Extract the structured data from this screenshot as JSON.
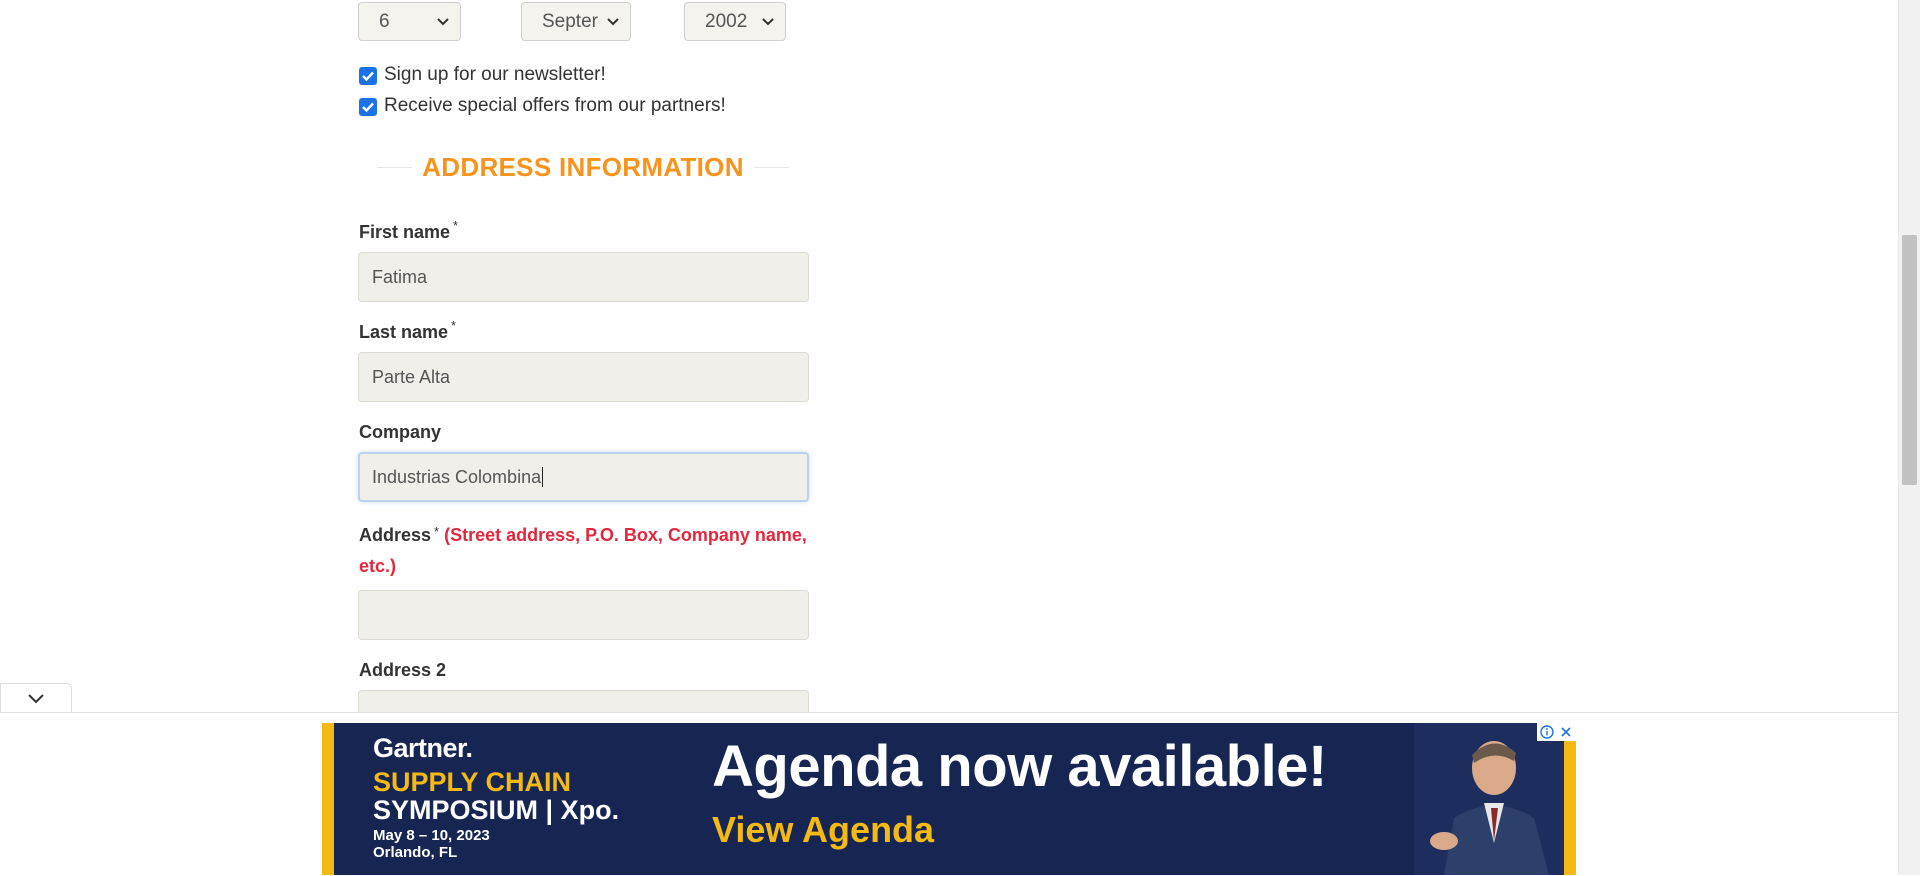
{
  "dob": {
    "day": "6",
    "month": "Septer",
    "year": "2002"
  },
  "checkboxes": [
    {
      "label": "Sign up for our newsletter!",
      "checked": true
    },
    {
      "label": "Receive special offers from our partners!",
      "checked": true
    }
  ],
  "section_title": "ADDRESS INFORMATION",
  "fields": {
    "first_name": {
      "label": "First name",
      "required_mark": "*",
      "value": "Fatima"
    },
    "last_name": {
      "label": "Last name",
      "required_mark": "*",
      "value": "Parte Alta"
    },
    "company": {
      "label": "Company",
      "value": "Industrias Colombina"
    },
    "address": {
      "label": "Address",
      "required_mark": "*",
      "hint_line1": "(Street address, P.O. Box, Company name,",
      "hint_line2": "etc.)",
      "value": ""
    },
    "address2": {
      "label": "Address 2",
      "value": ""
    }
  },
  "ad": {
    "brand": "Gartner.",
    "event_line1": "SUPPLY CHAIN",
    "event_line2": "SYMPOSIUM | Xpo.",
    "dates": "May 8 – 10, 2023",
    "location": "Orlando, FL",
    "headline": "Agenda now available!",
    "cta": "View Agenda"
  },
  "colors": {
    "accent": "#f7941d",
    "hint_red": "#e3273d",
    "checkbox_blue": "#1a73e8",
    "ad_navy": "#172552",
    "ad_gold": "#f5b914"
  },
  "icons": {
    "select_chevron": "chevron-down-icon",
    "collapse": "chevron-down-icon",
    "ad_info": "info-icon",
    "ad_close": "close-icon"
  }
}
